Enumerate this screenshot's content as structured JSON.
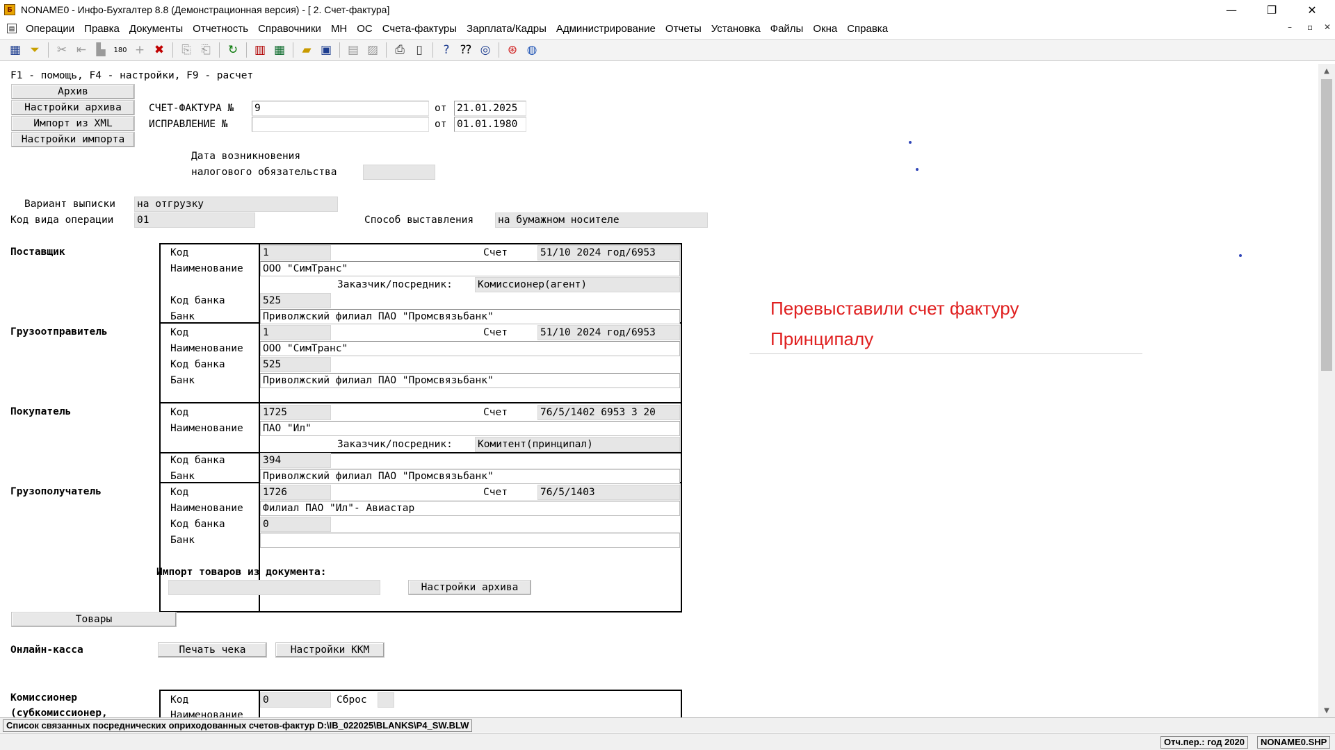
{
  "window": {
    "title": "NONAME0 - Инфо-Бухгалтер 8.8 (Демонстрационная версия) - [  2. Счет-фактура]",
    "minimize": "—",
    "maximize": "❐",
    "close": "✕"
  },
  "menu": [
    "Операции",
    "Правка",
    "Документы",
    "Отчетность",
    "Справочники",
    "МН",
    "ОС",
    "Счета-фактуры",
    "Зарплата/Кадры",
    "Администрирование",
    "Отчеты",
    "Установка",
    "Файлы",
    "Окна",
    "Справка"
  ],
  "mdi": {
    "minimize": "–",
    "restore": "▫",
    "close": "✕"
  },
  "toolbar": {
    "icons": [
      "table-icon",
      "filter-icon",
      "cut-icon",
      "move-icon",
      "paste-icon",
      "number-icon",
      "plus-icon",
      "delete-icon",
      "copy-icon",
      "copy-doc-icon",
      "refresh-icon",
      "report-icon",
      "calculator-icon",
      "open-folder-icon",
      "save-icon",
      "list-icon",
      "list2-icon",
      "print-icon",
      "preview-icon",
      "help-icon",
      "context-help-icon",
      "compass-icon",
      "lifebuoy-icon",
      "globe-icon"
    ]
  },
  "form": {
    "hint": "F1 - помощь, F4 - настройки, F9 - расчет",
    "left_buttons": [
      "Архив",
      "Настройки архива",
      "Импорт из XML",
      "Настройки импорта"
    ],
    "invoice_label": "СЧЕТ-ФАКТУРА №",
    "invoice_number": "9",
    "ot": "от",
    "invoice_date": "21.01.2025",
    "correction_label": "ИСПРАВЛЕНИЕ   №",
    "correction_number": "",
    "correction_date": "01.01.1980",
    "tax_date_label1": "Дата возникновения",
    "tax_date_label2": "налогового обязательства",
    "tax_date_value": "",
    "variant_label": "Вариант выписки",
    "variant_value": "на отгрузку",
    "op_code_label": "Код вида операции",
    "op_code_value": "01",
    "method_label": "Способ выставления",
    "method_value": "на бумажном носителе",
    "supplier": {
      "section": "Поставщик",
      "code_label": "Код",
      "code": "1",
      "account_label": "Счет",
      "account": "51/10  2024 год/6953",
      "name_label": "Наименование",
      "name": "ООО \"СимТранс\"",
      "agent_label": "Заказчик/посредник:",
      "agent": "Комиссионер(агент)",
      "bank_code_label": "Код банка",
      "bank_code": "525",
      "bank_label": "Банк",
      "bank": "Приволжский филиал ПАО \"Промсвязьбанк\""
    },
    "shipper": {
      "section": "Грузоотправитель",
      "code_label": "Код",
      "code": "1",
      "account_label": "Счет",
      "account": "51/10  2024 год/6953",
      "name_label": "Наименование",
      "name": "ООО \"СимТранс\"",
      "bank_code_label": "Код банка",
      "bank_code": "525",
      "bank_label": "Банк",
      "bank": "Приволжский филиал ПАО \"Промсвязьбанк\""
    },
    "buyer": {
      "section": "Покупатель",
      "code_label": "Код",
      "code": "1725",
      "account_label": "Счет",
      "account": "76/5/1402 6953 3  20",
      "name_label": "Наименование",
      "name": "ПАО \"Ил\"",
      "agent_label": "Заказчик/посредник:",
      "agent": "Комитент(принципал)",
      "bank_code_label": "Код банка",
      "bank_code": "394",
      "bank_label": "Банк",
      "bank": "Приволжский филиал ПАО \"Промсвязьбанк\""
    },
    "consignee": {
      "section": "Грузополучатель",
      "code_label": "Код",
      "code": "1726",
      "account_label": "Счет",
      "account": "76/5/1403",
      "name_label": "Наименование",
      "name": "Филиал ПАО \"Ил\"- Авиастар",
      "bank_code_label": "Код банка",
      "bank_code": "0",
      "bank_label": "Банк",
      "bank": ""
    },
    "import_label": "Импорт товаров из документа:",
    "import_value": "",
    "import_settings_button": "Настройки архива",
    "goods_button": "Товары",
    "online_kassa_label": "Онлайн-касса",
    "print_check_button": "Печать чека",
    "kkm_settings_button": "Настройки ККМ",
    "commissioner": {
      "section1": "Комиссионер",
      "section2": "(субкомиссионер,",
      "code_label": "Код",
      "code": "0",
      "reset_label": "Сброс",
      "name_label": "Наименование"
    }
  },
  "annotation": "Перевыставили счет фактуру Принципалу",
  "status": "Список связанных посреднических оприходованных счетов-фактур D:\\IB_022025\\BLANKS\\P4_SW.BLW",
  "bottom": {
    "period": "Отч.пер.: год 2020",
    "file": "NONAME0.SHP"
  }
}
